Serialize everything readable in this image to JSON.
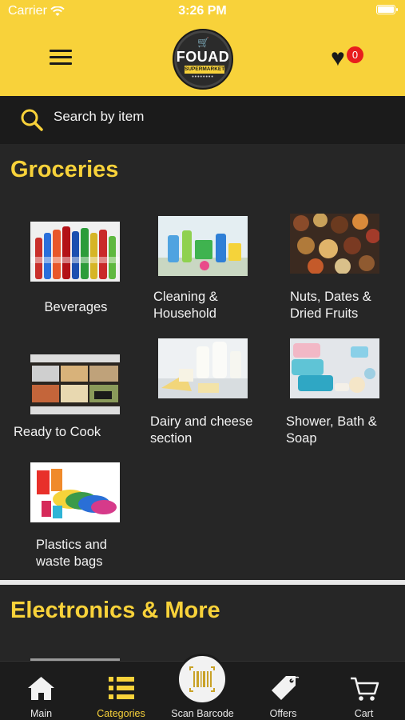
{
  "status": {
    "carrier": "Carrier",
    "time": "3:26 PM"
  },
  "header": {
    "logo": {
      "name": "FOUAD",
      "sub": "SUPERMARKET"
    },
    "favorites_count": "0"
  },
  "search": {
    "placeholder": "Search by item"
  },
  "sections": [
    {
      "title": "Groceries",
      "categories": [
        {
          "label_line1": "Beverages",
          "label_line2": "",
          "image": "beverages-photo"
        },
        {
          "label_line1": "Cleaning &",
          "label_line2": "Household",
          "image": "cleaning-photo"
        },
        {
          "label_line1": "Nuts, Dates &",
          "label_line2": "Dried Fruits",
          "image": "nuts-photo"
        },
        {
          "label_line1": "Ready to Cook",
          "label_line2": "",
          "image": "ready-to-cook-photo"
        },
        {
          "label_line1": "Dairy and cheese",
          "label_line2": "section",
          "image": "dairy-photo"
        },
        {
          "label_line1": "Shower, Bath &",
          "label_line2": "Soap",
          "image": "shower-photo"
        },
        {
          "label_line1": "Plastics and",
          "label_line2": "waste bags",
          "image": "plastics-photo"
        }
      ]
    },
    {
      "title": "Electronics & More",
      "categories": []
    }
  ],
  "tabbar": {
    "items": [
      {
        "label": "Main",
        "icon": "home-icon",
        "active": false
      },
      {
        "label": "Categories",
        "icon": "list-icon",
        "active": true
      },
      {
        "label": "Scan Barcode",
        "icon": "barcode-icon",
        "active": false
      },
      {
        "label": "Offers",
        "icon": "tag-icon",
        "active": false
      },
      {
        "label": "Cart",
        "icon": "cart-icon",
        "active": false
      }
    ]
  },
  "colors": {
    "accent": "#f8d23a",
    "background": "#262626",
    "badge": "#e81d1d"
  }
}
